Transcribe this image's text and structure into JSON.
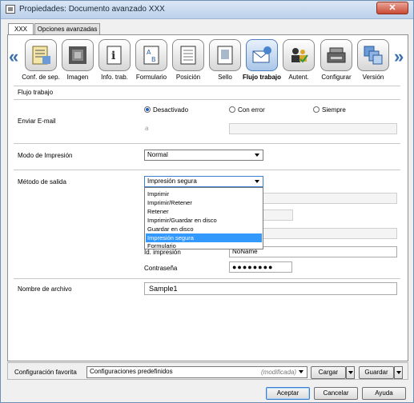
{
  "window": {
    "title": "Propiedades: Documento avanzado XXX",
    "close_label": "✕"
  },
  "tabs": [
    {
      "label": "XXX",
      "active": true
    },
    {
      "label": "Opciones avanzadas",
      "active": false
    }
  ],
  "toolbar": {
    "items": [
      {
        "label": "Conf. de sep.",
        "icon": "separator-settings-icon"
      },
      {
        "label": "Imagen",
        "icon": "image-icon"
      },
      {
        "label": "Info. trab.",
        "icon": "job-info-icon"
      },
      {
        "label": "Formulario",
        "icon": "form-icon"
      },
      {
        "label": "Posición",
        "icon": "position-icon"
      },
      {
        "label": "Sello",
        "icon": "stamp-icon"
      },
      {
        "label": "Flujo trabajo",
        "icon": "workflow-icon",
        "selected": true
      },
      {
        "label": "Autent.",
        "icon": "authentication-icon"
      },
      {
        "label": "Configurar",
        "icon": "configure-icon"
      },
      {
        "label": "Versión",
        "icon": "version-icon"
      }
    ]
  },
  "workflow": {
    "group_title": "Flujo trabajo",
    "email": {
      "label": "Enviar E-mail",
      "options": [
        "Desactivado",
        "Con error",
        "Siempre"
      ],
      "selected": "Desactivado",
      "address_prefix": "a",
      "address_value": ""
    },
    "print_mode": {
      "label": "Modo de Impresión",
      "value": "Normal"
    },
    "output": {
      "label": "Método de salida",
      "value": "Impresión segura",
      "options": [
        "Imprimir",
        "Imprimir/Retener",
        "Retener",
        "Imprimir/Guardar en disco",
        "Guardar en disco",
        "Impresión segura",
        "Formulario"
      ],
      "id_label": "Id. impresión",
      "id_value": "NoName",
      "password_label": "Contraseña",
      "password_value": "●●●●●●●●"
    },
    "filename": {
      "label": "Nombre de archivo",
      "value": "Sample1"
    }
  },
  "favorites": {
    "label": "Configuración favorita",
    "value": "Configuraciones predefinidos",
    "modified": "(modificada)",
    "load_label": "Cargar",
    "save_label": "Guardar"
  },
  "dialog": {
    "ok_label": "Aceptar",
    "cancel_label": "Cancelar",
    "help_label": "Ayuda"
  }
}
